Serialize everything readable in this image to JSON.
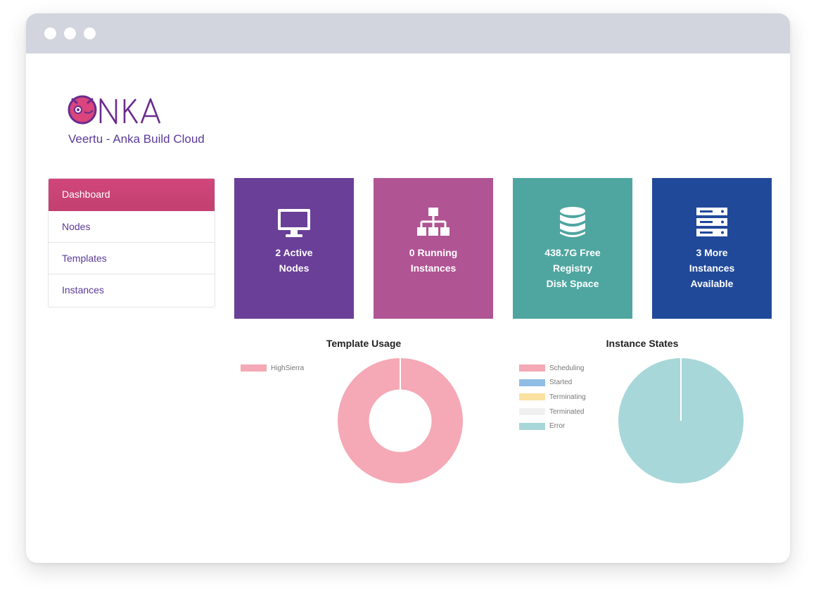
{
  "app": {
    "subtitle": "Veertu - Anka Build Cloud"
  },
  "sidebar": {
    "items": [
      {
        "label": "Dashboard",
        "active": true
      },
      {
        "label": "Nodes",
        "active": false
      },
      {
        "label": "Templates",
        "active": false
      },
      {
        "label": "Instances",
        "active": false
      }
    ]
  },
  "cards": [
    {
      "label": "2 Active\nNodes",
      "icon": "monitor-icon",
      "color": "#6a3f98"
    },
    {
      "label": "0 Running\nInstances",
      "icon": "hierarchy-icon",
      "color": "#b05494"
    },
    {
      "label": "438.7G Free\nRegistry\nDisk Space",
      "icon": "database-icon",
      "color": "#4fa6a0"
    },
    {
      "label": "3 More\nInstances\nAvailable",
      "icon": "server-icon",
      "color": "#21499a"
    }
  ],
  "chart_data": [
    {
      "type": "pie",
      "title": "Template Usage",
      "categories": [
        "HighSierra"
      ],
      "values": [
        100
      ],
      "colors": [
        "#f5a8b5"
      ],
      "legend": "left"
    },
    {
      "type": "pie",
      "title": "Instance States",
      "categories": [
        "Scheduling",
        "Started",
        "Terminating",
        "Terminated",
        "Error"
      ],
      "values": [
        0,
        0,
        0,
        0,
        100
      ],
      "colors": [
        "#f5a8b5",
        "#90bde6",
        "#fbe1a1",
        "#f0f0f0",
        "#a7d7d8"
      ],
      "legend": "left"
    }
  ]
}
